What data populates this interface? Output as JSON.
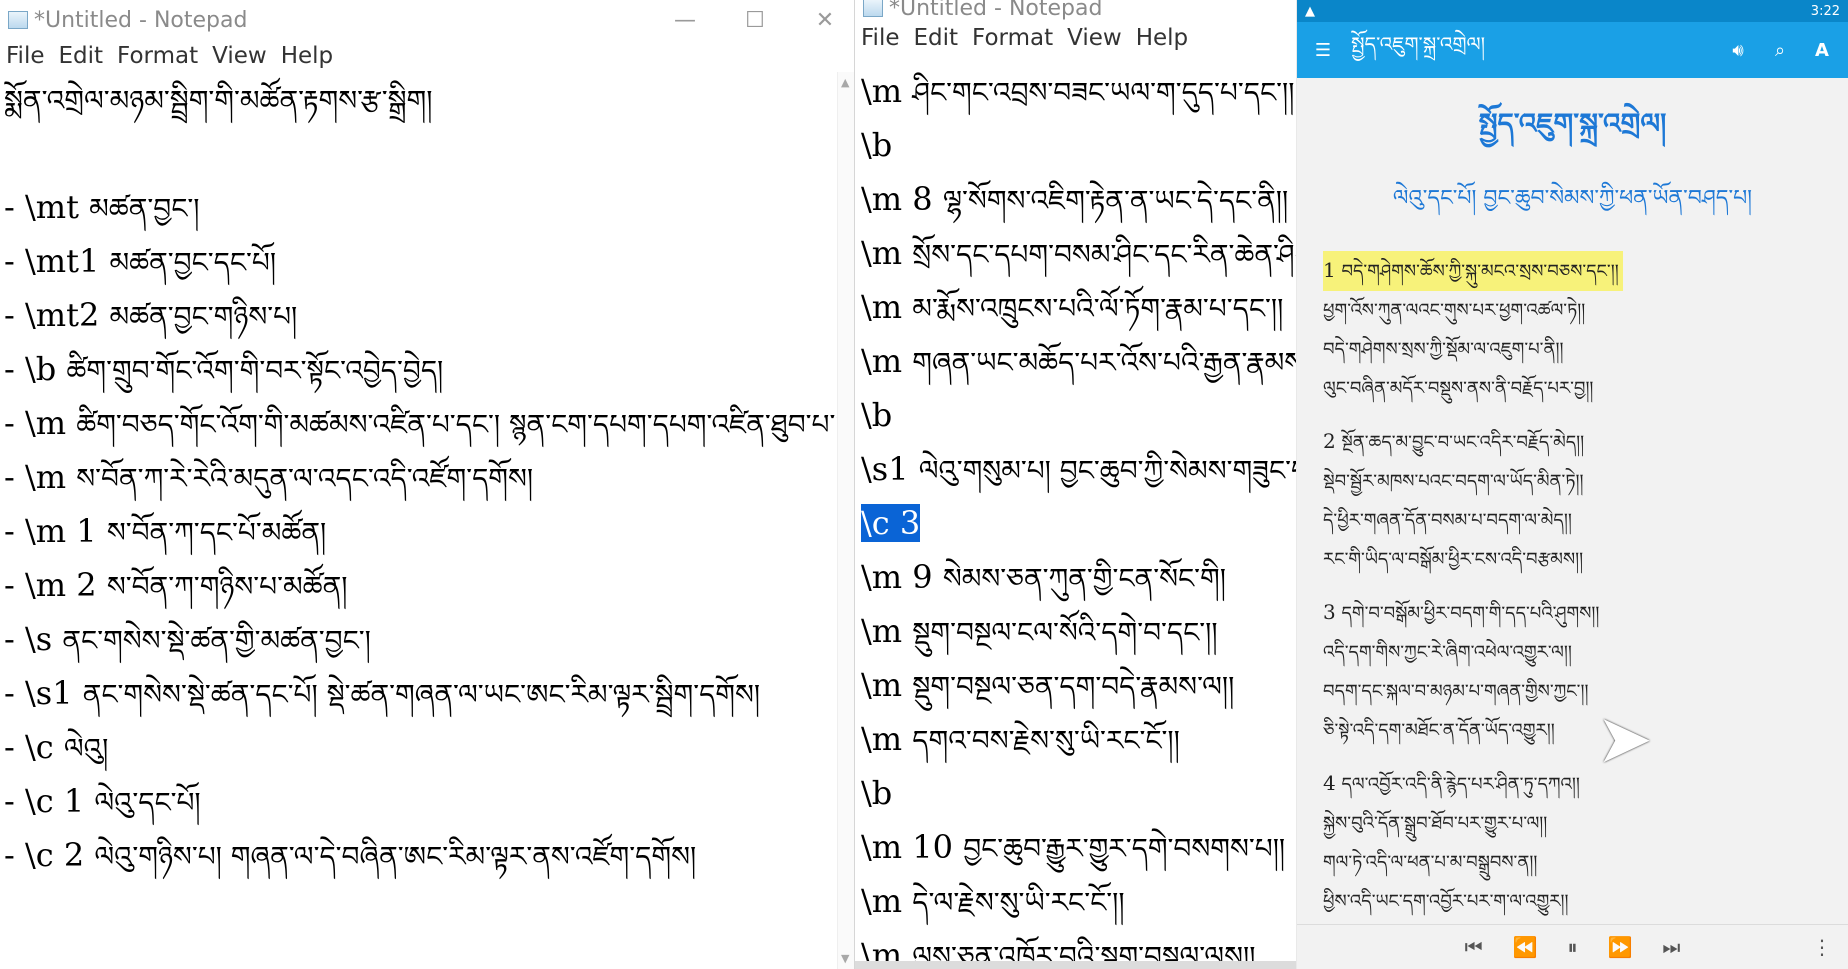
{
  "notepad1": {
    "title": "*Untitled - Notepad",
    "menu": [
      "File",
      "Edit",
      "Format",
      "View",
      "Help"
    ],
    "controls": {
      "minimize": "—",
      "maximize": "☐",
      "close": "✕"
    },
    "lines": [
      {
        "marker": "",
        "tibetan": "སྨོན་འགྲེལ་མཉམ་སྦྲིག་གི་མཚོན་རྟགས་རྩ་སྒྲིག།"
      },
      {
        "marker": "",
        "tibetan": ""
      },
      {
        "marker": "- \\mt",
        "tibetan": "མཚན་བྱང་།"
      },
      {
        "marker": "- \\mt1",
        "tibetan": "མཚན་བྱང་དང་པོ།"
      },
      {
        "marker": "- \\mt2",
        "tibetan": "མཚན་བྱང་གཉིས་པ།"
      },
      {
        "marker": "- \\b",
        "tibetan": "ཚིག་གྲུབ་གོང་འོག་གི་བར་སྟོང་འབྱེད་བྱེད།"
      },
      {
        "marker": "- \\m",
        "tibetan": "ཚིག་བཅད་གོང་འོག་གི་མཚམས་འཛིན་པ་དང་། སྙན་ངག་དཔག་དཔག་འཛིན་ཐུབ་པ་ཡིན།"
      },
      {
        "marker": "- \\m",
        "tibetan": "ས་བོན་ཀ་རེ་རེའི་མདུན་ལ་འདང་འདི་འཛོག་དགོས།"
      },
      {
        "marker": "- \\m 1",
        "tibetan": "ས་བོན་ཀ་དང་པོ་མཚོན།"
      },
      {
        "marker": "- \\m 2",
        "tibetan": "ས་བོན་ཀ་གཉིས་པ་མཚོན།"
      },
      {
        "marker": "- \\s",
        "tibetan": "ནང་གསེས་སྡེ་ཚན་གྱི་མཚན་བྱང་།"
      },
      {
        "marker": "- \\s1",
        "tibetan": "ནང་གསེས་སྡེ་ཚན་དང་པོ། སྡེ་ཚན་གཞན་ལ་ཡང་ཨང་རིམ་ལྟར་སྦྲིག་དགོས།"
      },
      {
        "marker": "- \\c",
        "tibetan": "ལེའུ།"
      },
      {
        "marker": "- \\c 1",
        "tibetan": "ལེའུ་དང་པོ།"
      },
      {
        "marker": "- \\c 2",
        "tibetan": "ལེའུ་གཉིས་པ། གཞན་ལ་དེ་བཞིན་ཨང་རིམ་ལྟར་ནས་འཛོག་དགོས།"
      }
    ]
  },
  "notepad2": {
    "title": "*Untitled - Notepad",
    "menu": [
      "File",
      "Edit",
      "Format",
      "View",
      "Help"
    ],
    "lines": [
      {
        "marker": "\\m",
        "tibetan": "ཤིང་གང་འབྲས་བཟང་ཡལ་ག་དུད་པ་དང་།།",
        "selected": false
      },
      {
        "marker": "\\b",
        "tibetan": "",
        "selected": false
      },
      {
        "marker": "\\m 8",
        "tibetan": "ལྷ་སོགས་འཇིག་རྟེན་ན་ཡང་དེ་དང་ནི།།",
        "selected": false
      },
      {
        "marker": "\\m",
        "tibetan": "སྲོས་དང་དཔག་བསམ་ཤིང་དང་རིན་ཆེན་ཤིང་།།",
        "selected": false
      },
      {
        "marker": "\\m",
        "tibetan": "མ་རྨོས་འཁྲུངས་པའི་ལོ་ཏོག་རྣམ་པ་དང་།།",
        "selected": false
      },
      {
        "marker": "\\m",
        "tibetan": "གཞན་ཡང་མཆོད་པར་འོས་པའི་རྒྱན་རྣམས་ནི།།",
        "selected": false
      },
      {
        "marker": "\\b",
        "tibetan": "",
        "selected": false
      },
      {
        "marker": "\\s1",
        "tibetan": "ལེའུ་གསུམ་པ། བྱང་ཆུབ་ཀྱི་སེམས་གཟུང་བ།",
        "selected": false
      },
      {
        "marker": "\\c 3",
        "tibetan": "",
        "selected": true
      },
      {
        "marker": "\\m 9",
        "tibetan": "སེམས་ཅན་ཀུན་གྱི་ངན་སོང་གི།",
        "selected": false
      },
      {
        "marker": "\\m",
        "tibetan": "སྡུག་བསྔལ་ངལ་སོའི་དགེ་བ་དང་།།",
        "selected": false
      },
      {
        "marker": "\\m",
        "tibetan": "སྡུག་བསྔལ་ཅན་དག་བདེ་རྣམས་ལ།།",
        "selected": false
      },
      {
        "marker": "\\m",
        "tibetan": "དགའ་བས་རྗེས་སུ་ཡི་རང་ངོ་།།",
        "selected": false
      },
      {
        "marker": "\\b",
        "tibetan": "",
        "selected": false
      },
      {
        "marker": "\\m 10",
        "tibetan": "བྱང་ཆུབ་རྒྱུར་གྱུར་དགེ་བསགས་པ།།",
        "selected": false
      },
      {
        "marker": "\\m",
        "tibetan": "དེ་ལ་རྗེས་སུ་ཡི་རང་ངོ་།།",
        "selected": false
      },
      {
        "marker": "\\m",
        "tibetan": "ལུས་ཅན་འཁོར་བའི་སྡུག་བསྔལ་ལས།།",
        "selected": false
      }
    ]
  },
  "reader": {
    "status_time": "3:22",
    "appbar_title": "སྤྱོད་འཇུག་སྐྲ་འགྲེལ།",
    "icons": {
      "menu": "menu-icon",
      "volume": "volume-icon",
      "search": "search-icon",
      "font": "font-size-icon"
    },
    "font_label": "A",
    "book_title": "སྤྱོད་འཇུག་སྐྲ་འགྲེལ།",
    "book_subtitle": "ལེའུ་དང་པོ། བྱང་ཆུབ་སེམས་ཀྱི་ཕན་ཡོན་བཤད་པ།",
    "verses": [
      {
        "num": "1",
        "lines": [
          "བདེ་གཤེགས་ཆོས་ཀྱི་སྐུ་མངའ་སྲས་བཅས་དང་།།",
          "ཕྱག་འོས་ཀུན་ལའང་གུས་པར་ཕྱག་འཚལ་ཏེ།།",
          "བདེ་གཤེགས་སྲས་ཀྱི་སྡོམ་ལ་འཇུག་པ་ནི།།",
          "ལུང་བཞིན་མདོར་བསྡུས་ནས་ནི་བརྗོད་པར་བྱ།།"
        ]
      },
      {
        "num": "2",
        "lines": [
          "སྔོན་ཆད་མ་བྱུང་བ་ཡང་འདིར་བརྗོད་མེད།།",
          "སྡེབ་སྦྱོར་མཁས་པའང་བདག་ལ་ཡོད་མིན་ཏེ།།",
          "དེ་ཕྱིར་གཞན་དོན་བསམ་པ་བདག་ལ་མེད།།",
          "རང་གི་ཡིད་ལ་བསྒོམ་ཕྱིར་ངས་འདི་བརྩམས།།"
        ]
      },
      {
        "num": "3",
        "lines": [
          "དགེ་བ་བསྒོམ་ཕྱིར་བདག་གི་དད་པའི་ཤུགས།།",
          "འདི་དག་གིས་ཀྱང་རེ་ཞིག་འཕེལ་འགྱུར་ལ།།",
          "བདག་དང་སྐལ་བ་མཉམ་པ་གཞན་གྱིས་ཀྱང་།།",
          "ཅི་སྟེ་འདི་དག་མཐོང་ན་དོན་ཡོད་འགྱུར།།"
        ]
      },
      {
        "num": "4",
        "lines": [
          "དལ་འབྱོར་འདི་ནི་རྙེད་པར་ཤིན་ཏུ་དཀའ།།",
          "སྐྱེས་བུའི་དོན་སྒྲུབ་ཐོབ་པར་གྱུར་པ་ལ།།",
          "གལ་ཏེ་འདི་ལ་ཕན་པ་མ་བསྒྲུབས་ན།།",
          "ཕྱིས་འདི་ཡང་དག་འབྱོར་པར་ག་ལ་འགྱུར།།"
        ]
      }
    ],
    "highlighted_verse": 0,
    "highlight_color": "#f7f27a",
    "accent_color": "#1aa0e6",
    "player_icons": [
      "skip-first-icon",
      "rewind-icon",
      "pause-icon",
      "fast-forward-icon",
      "skip-last-icon",
      "more-vert-icon"
    ]
  }
}
